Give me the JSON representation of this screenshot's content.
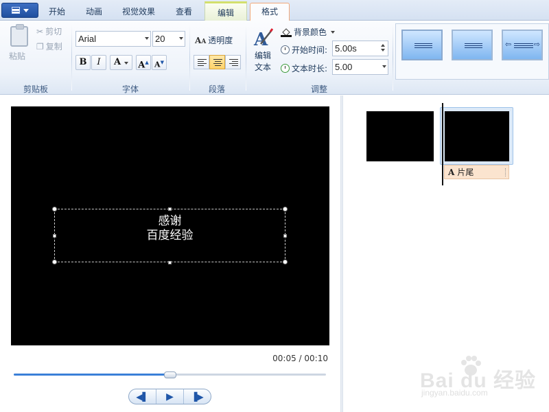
{
  "ribbon_tabs": {
    "app_menu": "app-menu",
    "home": "开始",
    "animations": "动画",
    "visual_effects": "视觉效果",
    "view": "查看",
    "edit": "编辑",
    "format": "格式",
    "active": "格式"
  },
  "clipboard": {
    "paste": "粘贴",
    "cut": "剪切",
    "copy": "复制",
    "group_label": "剪贴板"
  },
  "font": {
    "family": "Arial",
    "size": "20",
    "bold": "B",
    "italic": "I",
    "color": "A",
    "grow": "A",
    "shrink": "A",
    "group_label": "字体"
  },
  "paragraph": {
    "transparency": "透明度",
    "alignment_selected": "center",
    "group_label": "段落"
  },
  "adjust": {
    "edit_text_line1": "编辑",
    "edit_text_line2": "文本",
    "background_color": "背景颜色",
    "start_time_label": "开始时间:",
    "start_time_value": "5.00s",
    "text_duration_label": "文本时长:",
    "text_duration_value": "5.00",
    "group_label": "调整"
  },
  "effects_gallery": {
    "items": [
      "effect-none",
      "effect-plain",
      "effect-scroll"
    ]
  },
  "preview": {
    "caption_line1": "感谢",
    "caption_line2": "百度经验",
    "time_display": "00:05 / 00:10",
    "seek_fraction": 0.5
  },
  "storyboard": {
    "caption_label": "片尾",
    "caption_icon": "A"
  },
  "watermark": {
    "brand": "Bai du 经验",
    "url": "jingyan.baidu.com"
  },
  "colors": {
    "ribbon_bg": "#eef3fa",
    "active_tab_border": "#f0a87a",
    "context_tab_accent": "#d3e06c",
    "preview_bg": "#000000",
    "seek_fill": "#3a7fd8",
    "caption_chip": "#fbe4cf"
  }
}
